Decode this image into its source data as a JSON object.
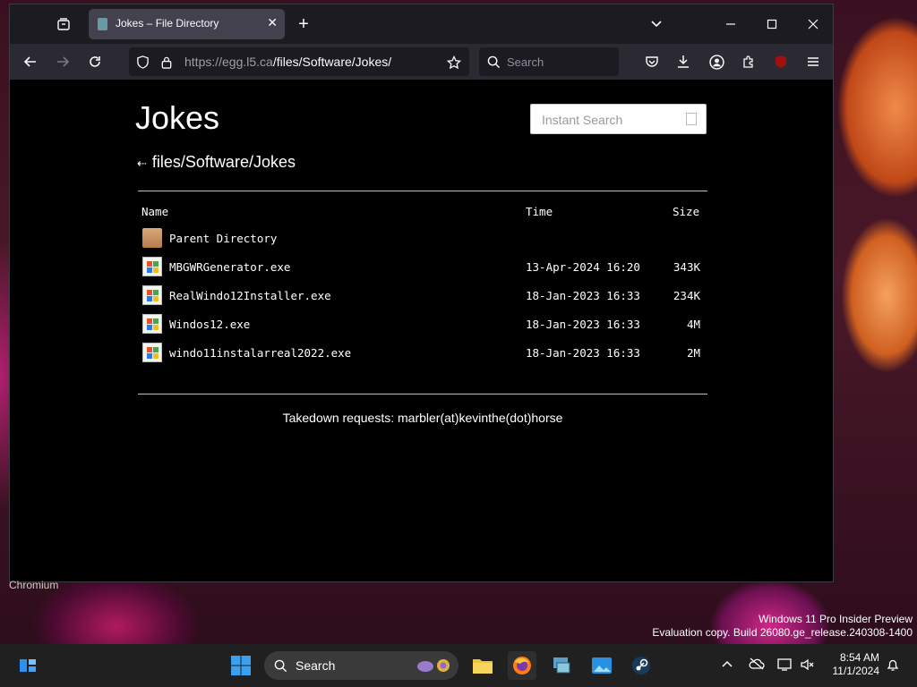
{
  "browser": {
    "tab_title": "Jokes – File Directory",
    "url_host": "https://egg.l5.ca",
    "url_path": "/files/Software/Jokes/",
    "search_placeholder": "Search"
  },
  "page": {
    "title": "Jokes",
    "instant_search_placeholder": "Instant Search",
    "breadcrumb_arrow": "⇠",
    "breadcrumb": "files/Software/Jokes",
    "columns": {
      "name": "Name",
      "time": "Time",
      "size": "Size"
    },
    "rows": [
      {
        "name": "Parent Directory",
        "time": "",
        "size": "",
        "icon": "folder-icon"
      },
      {
        "name": "MBGWRGenerator.exe",
        "time": "13-Apr-2024 16:20",
        "size": "343K",
        "icon": "exe-icon"
      },
      {
        "name": "RealWindo12Installer.exe",
        "time": "18-Jan-2023 16:33",
        "size": "234K",
        "icon": "exe-icon"
      },
      {
        "name": "Windos12.exe",
        "time": "18-Jan-2023 16:33",
        "size": "4M",
        "icon": "exe-icon"
      },
      {
        "name": "windo11instalarreal2022.exe",
        "time": "18-Jan-2023 16:33",
        "size": "2M",
        "icon": "exe-icon"
      }
    ],
    "footer": "Takedown requests: marbler(at)kevinthe(dot)horse"
  },
  "desktop": {
    "chromium_label": "Chromium",
    "watermark_line1": "Windows 11 Pro Insider Preview",
    "watermark_line2": "Evaluation copy. Build 26080.ge_release.240308-1400"
  },
  "taskbar": {
    "search_label": "Search",
    "time": "8:54 AM",
    "date": "11/1/2024"
  }
}
